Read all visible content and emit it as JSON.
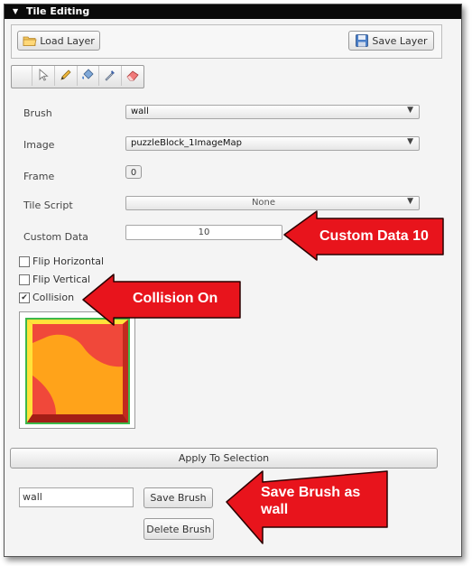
{
  "panel": {
    "title": "Tile Editing"
  },
  "toolbar": {
    "load_label": "Load Layer",
    "save_label": "Save Layer"
  },
  "tools": [
    "select-arrow-icon",
    "pencil-icon",
    "paint-bucket-icon",
    "eyedropper-icon",
    "eraser-icon"
  ],
  "fields": {
    "brush": {
      "label": "Brush",
      "value": "wall"
    },
    "image": {
      "label": "Image",
      "value": "puzzleBlock_1ImageMap"
    },
    "frame": {
      "label": "Frame",
      "value": "0"
    },
    "tile_script": {
      "label": "Tile Script",
      "value": "None"
    },
    "custom_data": {
      "label": "Custom Data",
      "value": "10"
    }
  },
  "checkboxes": {
    "flip_horizontal": {
      "label": "Flip Horizontal",
      "checked": false
    },
    "flip_vertical": {
      "label": "Flip Vertical",
      "checked": false
    },
    "collision": {
      "label": "Collision",
      "checked": true
    }
  },
  "actions": {
    "apply_label": "Apply To Selection",
    "brush_name_value": "wall",
    "save_brush_label": "Save Brush",
    "delete_brush_label": "Delete Brush"
  },
  "annotations": {
    "custom_data": "Custom Data 10",
    "collision": "Collision On",
    "save_brush_line1": "Save Brush as",
    "save_brush_line2": "wall"
  },
  "colors": {
    "callout_red": "#e8141c",
    "tile_orange": "#ffa31a",
    "tile_red": "#f0483a",
    "tile_yellow": "#ffe23a",
    "tile_green": "#3db84a"
  }
}
